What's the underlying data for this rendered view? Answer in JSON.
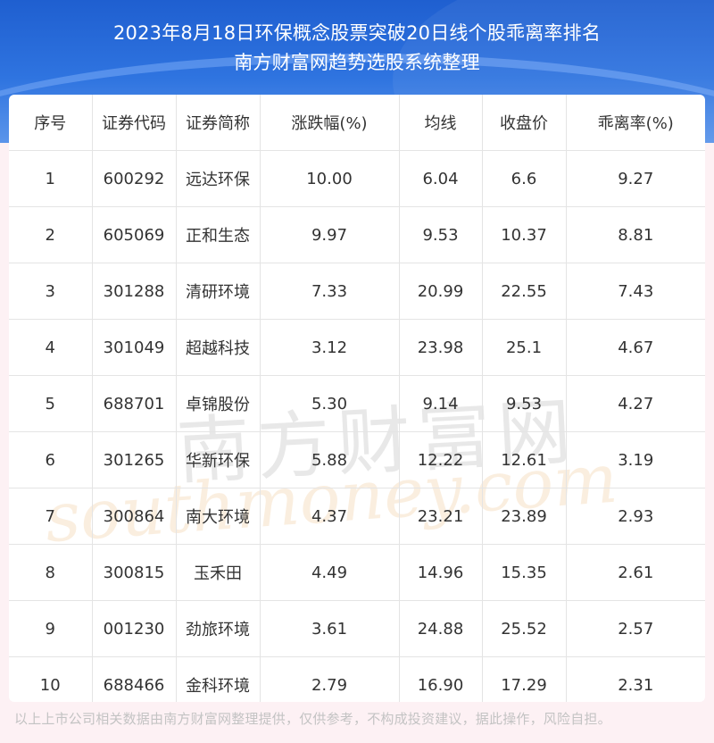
{
  "title": {
    "line1": "2023年8月18日环保概念股票突破20日线个股乖离率排名",
    "line2": "南方财富网趋势选股系统整理"
  },
  "table": {
    "headers": [
      "序号",
      "证券代码",
      "证券简称",
      "涨跌幅(%)",
      "均线",
      "收盘价",
      "乖离率(%)"
    ],
    "rows": [
      [
        "1",
        "600292",
        "远达环保",
        "10.00",
        "6.04",
        "6.6",
        "9.27"
      ],
      [
        "2",
        "605069",
        "正和生态",
        "9.97",
        "9.53",
        "10.37",
        "8.81"
      ],
      [
        "3",
        "301288",
        "清研环境",
        "7.33",
        "20.99",
        "22.55",
        "7.43"
      ],
      [
        "4",
        "301049",
        "超越科技",
        "3.12",
        "23.98",
        "25.1",
        "4.67"
      ],
      [
        "5",
        "688701",
        "卓锦股份",
        "5.30",
        "9.14",
        "9.53",
        "4.27"
      ],
      [
        "6",
        "301265",
        "华新环保",
        "5.88",
        "12.22",
        "12.61",
        "3.19"
      ],
      [
        "7",
        "300864",
        "南大环境",
        "4.37",
        "23.21",
        "23.89",
        "2.93"
      ],
      [
        "8",
        "300815",
        "玉禾田",
        "4.49",
        "14.96",
        "15.35",
        "2.61"
      ],
      [
        "9",
        "001230",
        "劲旅环境",
        "3.61",
        "24.88",
        "25.52",
        "2.57"
      ],
      [
        "10",
        "688466",
        "金科环境",
        "2.79",
        "16.90",
        "17.29",
        "2.31"
      ]
    ]
  },
  "watermark": {
    "cn": "南方财富网",
    "en": "southmoney.com"
  },
  "footer": "以上上市公司相关数据由南方财富网整理提供，仅供参考，不构成投资建议，据此操作，风险自担。"
}
